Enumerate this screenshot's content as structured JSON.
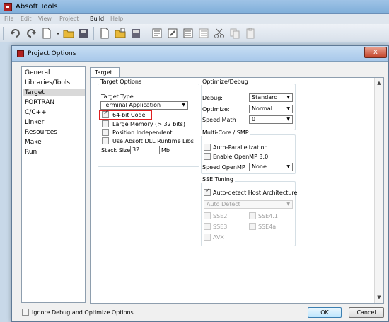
{
  "app": {
    "title": "Absoft Tools",
    "menu": [
      "File",
      "Edit",
      "View",
      "Project",
      "Build",
      "Help"
    ]
  },
  "dialog": {
    "title": "Project Options",
    "close_label": "x",
    "nav_items": [
      "General",
      "Libraries/Tools",
      "Target",
      "FORTRAN",
      "C/C++",
      "Linker",
      "Resources",
      "Make",
      "Run"
    ],
    "selected_nav": "Target",
    "tab_label": "Target",
    "target_options": {
      "title": "Target Options",
      "target_type_label": "Target Type",
      "target_type_value": "Terminal Application",
      "cb_64bit": "64-bit Code",
      "cb_large_memory": "Large Memory (> 32 bits)",
      "cb_position_independent": "Position Independent",
      "cb_dll": "Use Absoft DLL Runtime Libs",
      "stack_size_label": "Stack Size",
      "stack_size_value": "32",
      "stack_size_unit": "Mb"
    },
    "optimize": {
      "title": "Optimize/Debug",
      "debug_label": "Debug:",
      "debug_value": "Standard",
      "optimize_label": "Optimize:",
      "optimize_value": "Normal",
      "speed_math_label": "Speed Math",
      "speed_math_value": "0"
    },
    "multicore": {
      "title": "Multi-Core / SMP",
      "cb_auto_par": "Auto-Parallelization",
      "cb_openmp": "Enable OpenMP 3.0",
      "speed_openmp_label": "Speed OpenMP",
      "speed_openmp_value": "None"
    },
    "sse": {
      "title": "SSE Tuning",
      "cb_auto_detect": "Auto-detect Host Architecture",
      "arch_value": "Auto Detect",
      "sse2": "SSE2",
      "sse41": "SSE4.1",
      "sse3": "SSE3",
      "sse4a": "SSE4a",
      "avx": "AVX"
    },
    "footer": {
      "ignore_label": "Ignore Debug and Optimize Options",
      "ok_label": "OK",
      "cancel_label": "Cancel"
    }
  },
  "colors": {
    "highlight": "#e02020",
    "selected_nav_bg": "#d9d9d9"
  }
}
